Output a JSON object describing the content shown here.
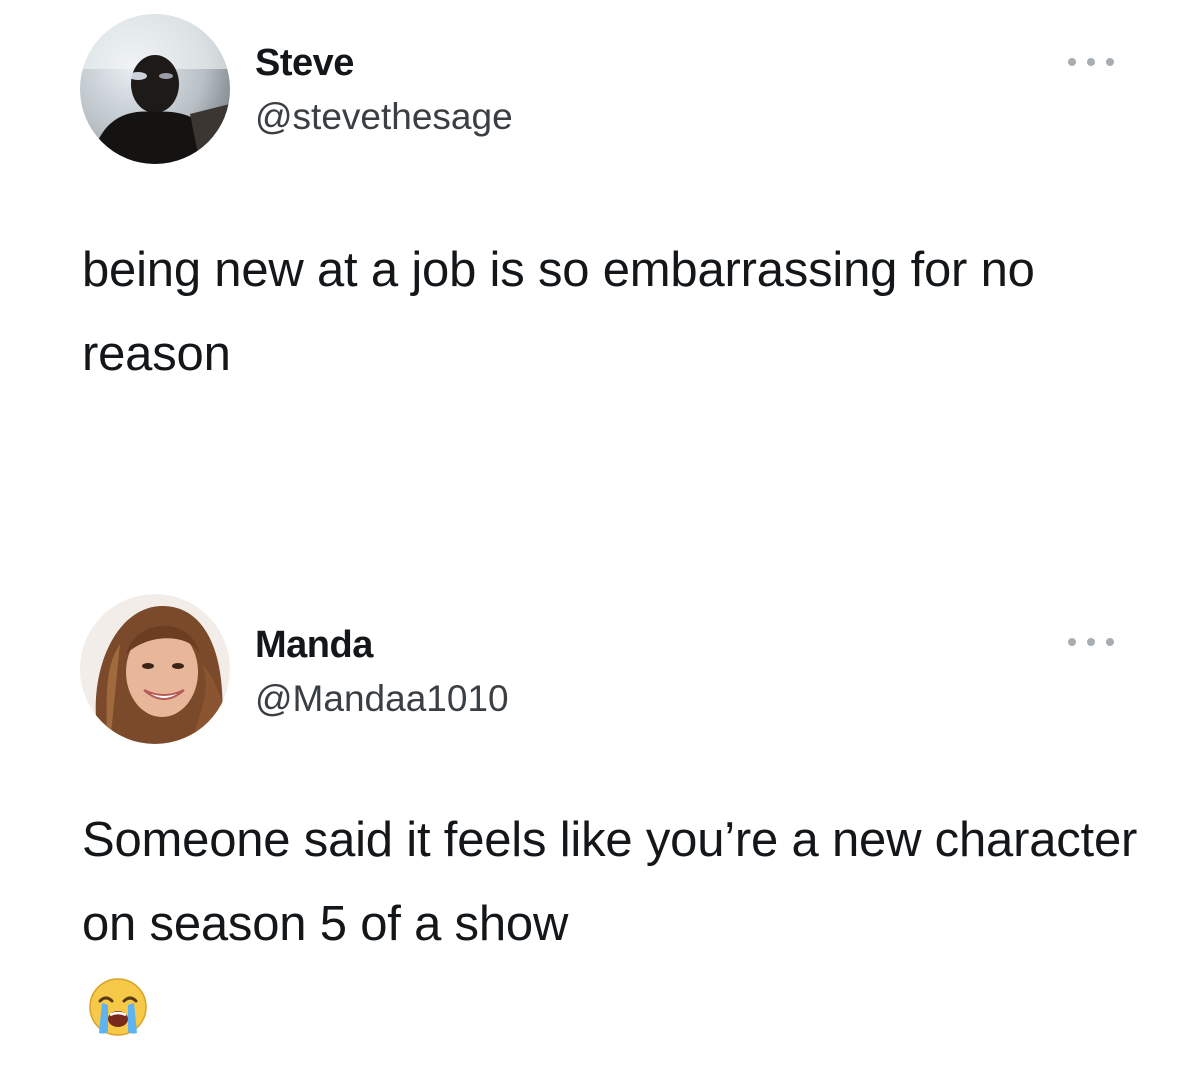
{
  "tweets": [
    {
      "display_name": "Steve",
      "handle": "@stevethesage",
      "text": "being new at a job is so embarrassing for no reason",
      "avatar_icon": "profile-photo",
      "more_icon": "more-options-icon"
    },
    {
      "display_name": "Manda",
      "handle": "@Mandaa1010",
      "text": "Someone said it feels like you’re a new character on season 5 of a show",
      "emoji_icon": "loudly-crying-face-icon",
      "avatar_icon": "profile-photo",
      "more_icon": "more-options-icon"
    }
  ],
  "colors": {
    "background": "#ffffff",
    "text": "#14171a",
    "handle": "#3a3f44",
    "more_dots": "#a8adb2"
  }
}
